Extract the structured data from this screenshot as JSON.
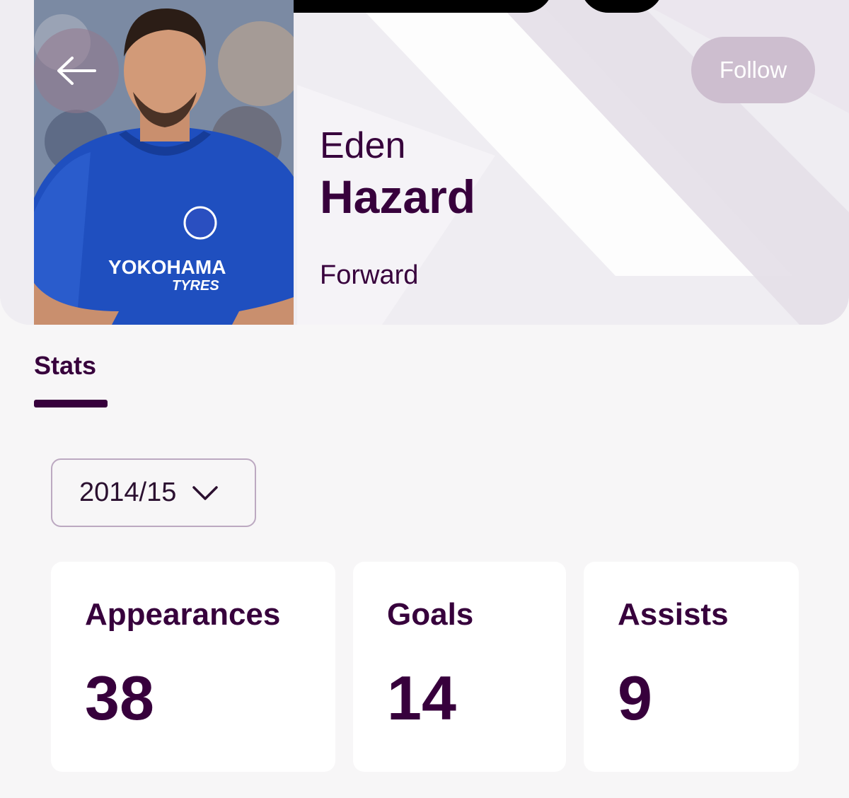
{
  "header": {
    "back_icon": "arrow-left-icon",
    "follow_label": "Follow"
  },
  "player": {
    "first_name": "Eden",
    "last_name": "Hazard",
    "position": "Forward",
    "photo_icon": "player-photo"
  },
  "tabs": [
    {
      "label": "Stats",
      "active": true
    }
  ],
  "season_selector": {
    "value": "2014/15",
    "icon": "chevron-down-icon"
  },
  "stats": [
    {
      "label": "Appearances",
      "value": "38"
    },
    {
      "label": "Goals",
      "value": "14"
    },
    {
      "label": "Assists",
      "value": "9"
    }
  ],
  "colors": {
    "brand": "#37003c",
    "background": "#f7f6f7",
    "card": "#ffffff",
    "follow_button": "#cdbecf"
  }
}
